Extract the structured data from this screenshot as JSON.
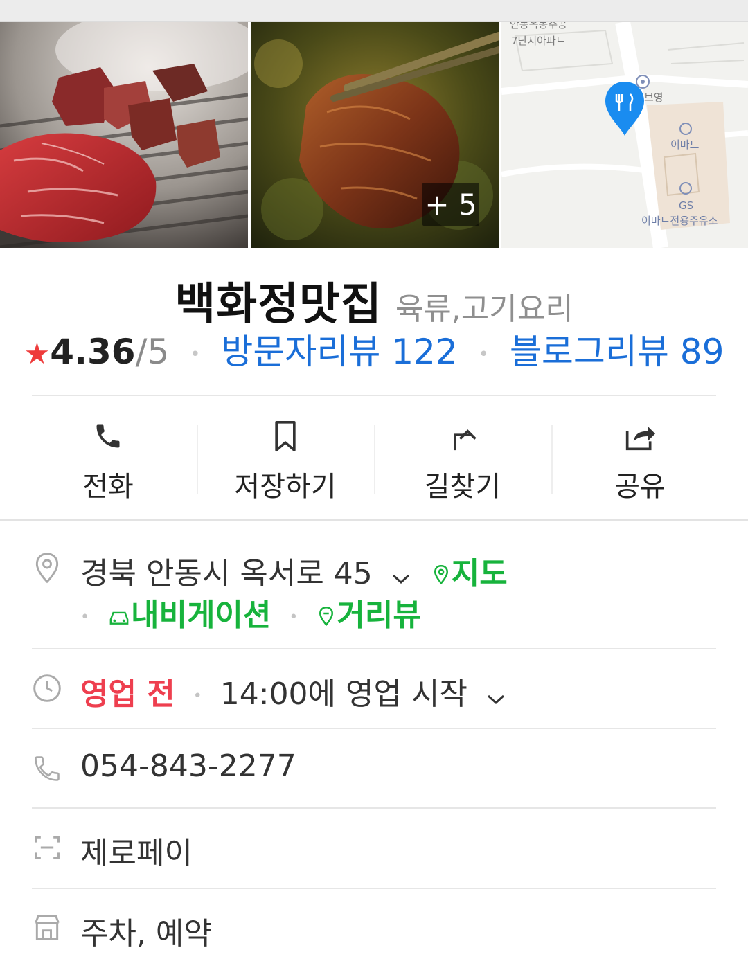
{
  "photos": {
    "more_count": "+ 5",
    "map": {
      "apartment_label_1": "안동옥동주공",
      "apartment_label_2": "7단지아파트",
      "partial_label": "브영",
      "store_label": "이마트",
      "gas_label_1": "GS",
      "gas_label_2": "이마트전용주유소"
    }
  },
  "place": {
    "name": "백화정맛집",
    "category": "육류,고기요리",
    "rating": {
      "star": "★",
      "score": "4.36",
      "out_of": "/5",
      "visitor_reviews": "방문자리뷰 122",
      "blog_reviews": "블로그리뷰 89"
    }
  },
  "actions": {
    "call": "전화",
    "save": "저장하기",
    "directions": "길찾기",
    "share": "공유"
  },
  "info": {
    "address": "경북 안동시 옥서로 45",
    "map_link": "지도",
    "navigation_link": "내비게이션",
    "street_view_link": "거리뷰",
    "status": "영업 전",
    "hours": "14:00에 영업 시작",
    "phone": "054-843-2277",
    "payment": "제로페이",
    "amenities": "주차, 예약"
  },
  "colors": {
    "accent_blue": "#1a6ed8",
    "link_green": "#17b33c",
    "status_red": "#ee3f4f",
    "star_red": "#ee3b3b",
    "map_pin": "#1a8cf0"
  }
}
